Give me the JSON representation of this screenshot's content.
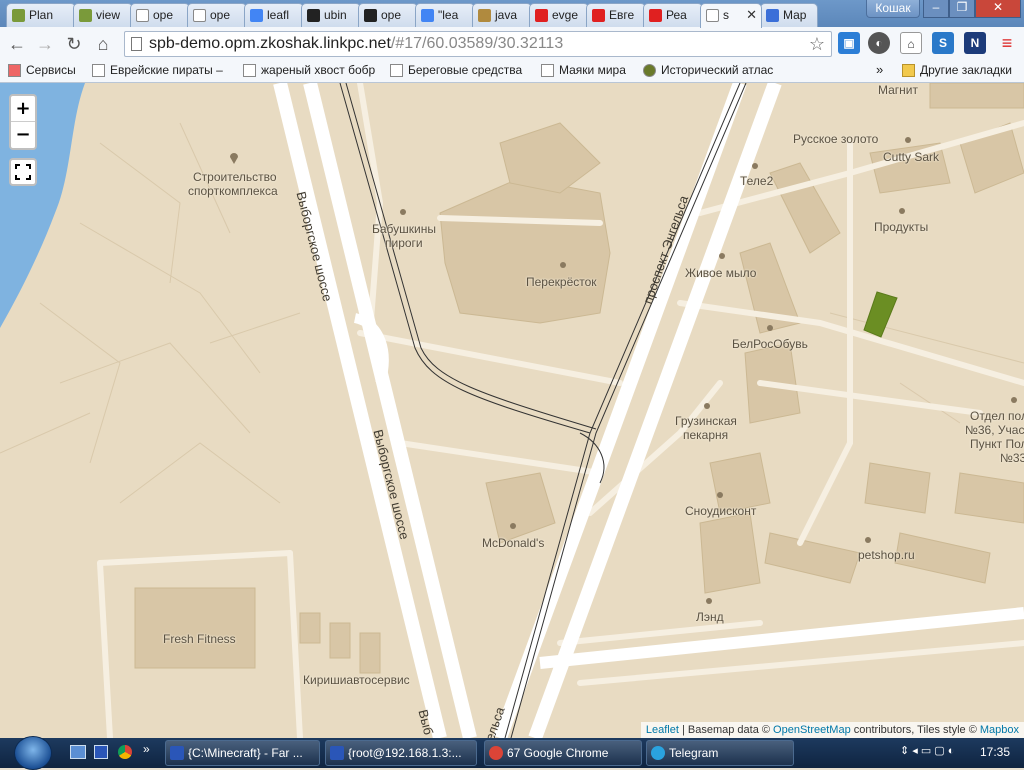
{
  "browser": {
    "tabs": [
      {
        "label": "Plan",
        "icon": "map-pin-icon",
        "color": "#7a9a3a"
      },
      {
        "label": "view",
        "icon": "map-pin-icon",
        "color": "#7a9a3a"
      },
      {
        "label": "ope",
        "icon": "document-icon",
        "color": "#ffffff"
      },
      {
        "label": "ope",
        "icon": "document-icon",
        "color": "#ffffff"
      },
      {
        "label": "leafl",
        "icon": "google-icon",
        "color": "#4285f4"
      },
      {
        "label": "ubin",
        "icon": "github-icon",
        "color": "#222222"
      },
      {
        "label": "ope",
        "icon": "github-icon",
        "color": "#222222"
      },
      {
        "label": "\"lea",
        "icon": "google-icon",
        "color": "#4285f4"
      },
      {
        "label": "java",
        "icon": "gear-icon",
        "color": "#b08a3e"
      },
      {
        "label": "evge",
        "icon": "youtube-icon",
        "color": "#e02020"
      },
      {
        "label": "Евге",
        "icon": "youtube-icon",
        "color": "#e02020"
      },
      {
        "label": "Реа",
        "icon": "youtube-icon",
        "color": "#e02020"
      },
      {
        "label": "s",
        "icon": "document-icon",
        "color": "#ffffff",
        "active": true
      },
      {
        "label": "Мар",
        "icon": "mapbox-icon",
        "color": "#3b6fd8"
      }
    ],
    "user_label": "Кошак",
    "url_host": "spb-demo.opm.zkoshak.linkpc.net",
    "url_path": "/#17/60.03589/30.32113",
    "bookmarks": [
      {
        "label": "Сервисы",
        "icon": "apps-grid-icon"
      },
      {
        "label": "Еврейские пираты –",
        "icon": "wikipedia-icon"
      },
      {
        "label": "жареный хвост бобр",
        "icon": "document-icon"
      },
      {
        "label": "Береговые средства",
        "icon": "abc-icon"
      },
      {
        "label": "Маяки мира",
        "icon": "document-icon"
      },
      {
        "label": "Исторический атлас",
        "icon": "globe-icon"
      }
    ],
    "other_bookmarks": "Другие закладки",
    "more_bookmarks": "»"
  },
  "map": {
    "zoom_in": "+",
    "zoom_out": "−",
    "labels": {
      "magnit": "Магнит",
      "russkoe_zoloto": "Русское золото",
      "cutty_sark": "Cutty Sark",
      "tele2": "Теле2",
      "stroitelstvo_1": "Строительство",
      "stroitelstvo_2": "спорткомплекса",
      "babushkiny_1": "Бабушкины",
      "babushkiny_2": "пироги",
      "produkty": "Продукты",
      "perekrestok": "Перекрёсток",
      "zhivoe_mylo": "Живое мыло",
      "belrosobuv": "БелРосОбувь",
      "gruzinskaya_1": "Грузинская",
      "gruzinskaya_2": "пекарня",
      "otdel_1": "Отдел пол",
      "otdel_2": "№36, Участ",
      "otdel_3": "Пункт Пол",
      "otdel_4": "№33",
      "snoudiskont": "Сноудисконт",
      "mcdonalds": "McDonald's",
      "petshop": "petshop.ru",
      "fresh_fitness": "Fresh Fitness",
      "lend": "Лэнд",
      "kirishiavtoservis": "Киришиавтосервис"
    },
    "roads": {
      "vyborgskoe_1": "Выборгское шоссе",
      "vyborgskoe_2": "Выборгское шоссе",
      "vyborgskoe_3": "Выб",
      "engelsa_1": "проспект Энгельса",
      "engelsa_2": "ельса"
    },
    "attribution": {
      "leaflet": "Leaflet",
      "sep1": " | Basemap data © ",
      "osm": "OpenStreetMap",
      "mid": " contributors, Tiles style © ",
      "mapbox": "Mapbox"
    }
  },
  "taskbar": {
    "items": [
      {
        "label": "{C:\\Minecraft} - Far ...",
        "icon": "far-icon"
      },
      {
        "label": "{root@192.168.1.3:...",
        "icon": "far-icon"
      },
      {
        "label": "67 Google Chrome",
        "icon": "chrome-icon"
      },
      {
        "label": "Telegram",
        "icon": "telegram-icon"
      }
    ],
    "clock": "17:35"
  },
  "colors": {
    "map_bg": "#e8dbc2",
    "road": "#ffffff",
    "water": "#7fb3e0",
    "highlight_polygon": "#6b8e23",
    "link": "#0078a8"
  }
}
